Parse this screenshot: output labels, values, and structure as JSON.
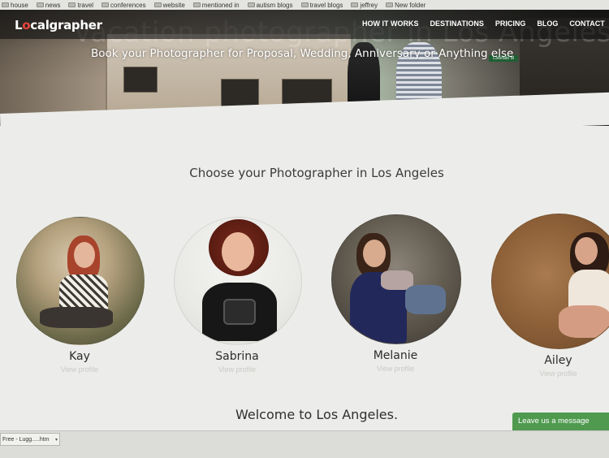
{
  "bookmarks": [
    "house",
    "news",
    "travel",
    "conferences",
    "website",
    "mentioned in",
    "autism blogs",
    "travel blogs",
    "jeffrey",
    "New folder"
  ],
  "hero": {
    "logo_prefix": "L",
    "logo_o": "o",
    "logo_suffix": "calgrapher",
    "bg_title": "Vacation photographer in Los Angeles",
    "subtitle": "Book your Photographer for Proposal, Wedding, Anniversary or Anything else",
    "street_sign": "Colorado Bl",
    "nav": [
      "HOW IT WORKS",
      "DESTINATIONS",
      "PRICING",
      "BLOG",
      "CONTACT"
    ]
  },
  "section": {
    "title": "Choose your Photographer in Los Angeles",
    "view_label": "View profile",
    "photographers": [
      {
        "name": "Kay"
      },
      {
        "name": "Sabrina"
      },
      {
        "name": "Melanie"
      },
      {
        "name": "Ailey"
      }
    ],
    "welcome": "Welcome to Los Angeles."
  },
  "chat": {
    "label": "Leave us a message"
  },
  "downloads": {
    "item": "Free - Lugg.....htm"
  },
  "colors": {
    "accent_red": "#e8443b",
    "chat_green": "#4f9a4f",
    "nav_bg": "#141414"
  }
}
